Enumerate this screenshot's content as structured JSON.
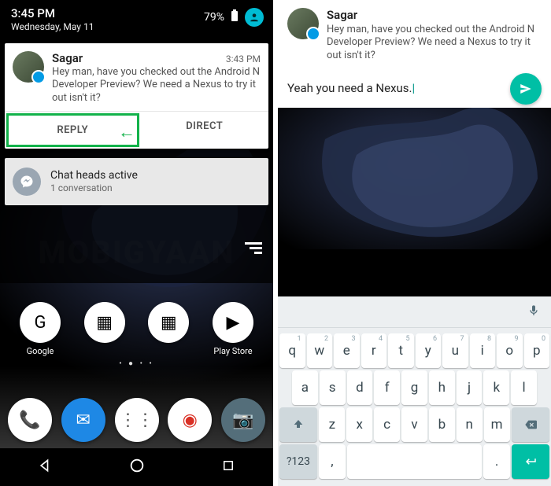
{
  "left": {
    "status": {
      "time": "3:45 PM",
      "date": "Wednesday, May 11",
      "battery": "79%"
    },
    "notification": {
      "sender": "Sagar",
      "time": "3:43 PM",
      "message": "Hey man, have you checked out the Android N Developer Preview? We need a Nexus to try it out isn't it?",
      "action_reply": "REPLY",
      "action_direct": "DIRECT"
    },
    "chatheads": {
      "title": "Chat heads active",
      "subtitle": "1 conversation"
    },
    "home_apps": [
      {
        "label": "Google",
        "icon": "google-icon",
        "glyph": "G"
      },
      {
        "label": "",
        "icon": "folder-icon",
        "glyph": "▦"
      },
      {
        "label": "",
        "icon": "folder-icon",
        "glyph": "▦"
      },
      {
        "label": "Play Store",
        "icon": "play-store-icon",
        "glyph": "▶"
      }
    ],
    "dock_apps": [
      {
        "icon": "phone-icon",
        "glyph": "📞",
        "bg": "#ffffff",
        "fg": "#1565c0"
      },
      {
        "icon": "messenger-icon",
        "glyph": "✉",
        "bg": "#1e88e5",
        "fg": "#fff"
      },
      {
        "icon": "app-drawer-icon",
        "glyph": "⋮⋮",
        "bg": "#ffffff",
        "fg": "#555"
      },
      {
        "icon": "chrome-icon",
        "glyph": "◉",
        "bg": "#ffffff",
        "fg": "#d93025"
      },
      {
        "icon": "camera-icon",
        "glyph": "📷",
        "bg": "#546e7a",
        "fg": "#fff"
      }
    ],
    "watermark": "MOBIGYAAN"
  },
  "right": {
    "sender": "Sagar",
    "message": "Hey man, have you checked out the Android N Developer Preview? We need a Nexus to try it out isn't it?",
    "reply_text": "Yeah you need a Nexus.",
    "keyboard": {
      "row1": [
        {
          "k": "q",
          "h": "1"
        },
        {
          "k": "w",
          "h": "2"
        },
        {
          "k": "e",
          "h": "3"
        },
        {
          "k": "r",
          "h": "4"
        },
        {
          "k": "t",
          "h": "5"
        },
        {
          "k": "y",
          "h": "6"
        },
        {
          "k": "u",
          "h": "7"
        },
        {
          "k": "i",
          "h": "8"
        },
        {
          "k": "o",
          "h": "9"
        },
        {
          "k": "p",
          "h": "0"
        }
      ],
      "row2": [
        "a",
        "s",
        "d",
        "f",
        "g",
        "h",
        "j",
        "k",
        "l"
      ],
      "row3": [
        "z",
        "x",
        "c",
        "v",
        "b",
        "n",
        "m"
      ],
      "symbols_key": "?123",
      "comma_key": ",",
      "period_key": "."
    }
  }
}
